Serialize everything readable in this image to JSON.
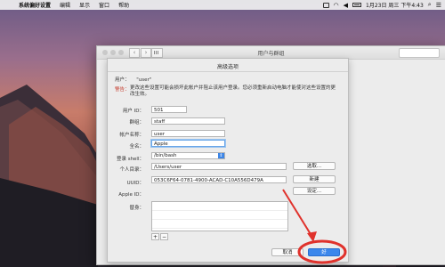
{
  "menubar": {
    "app_name": "系统偏好设置",
    "items": [
      "编辑",
      "显示",
      "窗口",
      "帮助"
    ],
    "clock": "1月23日 周三 下午4:43"
  },
  "window": {
    "title": "用户与群组"
  },
  "sheet": {
    "title": "高级选项",
    "user_label": "用户：",
    "user_value": "\"user\"",
    "warning_label": "警告：",
    "warning_text": "更改这些设置可能会损坏此帐户并阻止该用户登录。您必须重新启动电脑才能使对这些设置的更改生效。",
    "fields": {
      "uid_label": "用户 ID：",
      "uid_value": "501",
      "group_label": "群组：",
      "group_value": "staff",
      "account_label": "帐户名称：",
      "account_value": "user",
      "fullname_label": "全名：",
      "fullname_value": "Apple",
      "shell_label": "登录 shell：",
      "shell_value": "/bin/bash",
      "home_label": "个人目录：",
      "home_value": "/Users/user",
      "uuid_label": "UUID：",
      "uuid_value": "053C6F64-0781-4900-ACAD-C10A556D479A",
      "appleid_label": "Apple ID：",
      "aliases_label": "替身："
    },
    "buttons": {
      "choose": "选取...",
      "create": "新建",
      "set": "设定...",
      "add": "+",
      "remove": "−",
      "cancel": "取消",
      "ok": "好"
    }
  },
  "colors": {
    "accent": "#3b87ec",
    "warning": "#c43a2a",
    "annotation": "#e0322c"
  }
}
